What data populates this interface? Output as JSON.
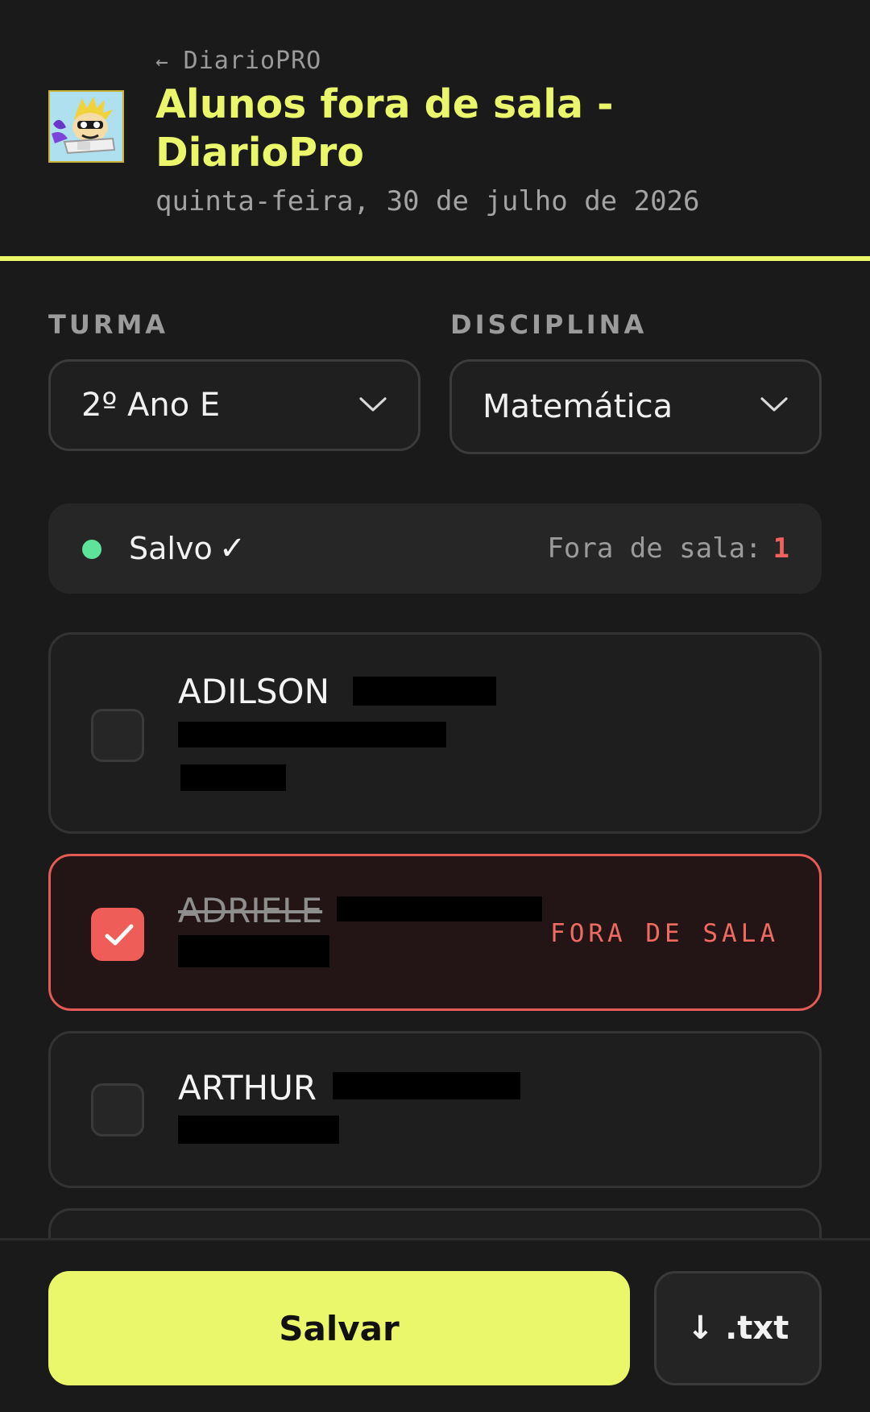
{
  "header": {
    "back_arrow": "←",
    "back_label": "DiarioPRO",
    "title": "Alunos fora de sala - DiarioPro",
    "date": "quinta-feira, 30 de julho de 2026"
  },
  "filters": {
    "turma": {
      "label": "TURMA",
      "value": "2º Ano E"
    },
    "disciplina": {
      "label": "DISCIPLINA",
      "value": "Matemática"
    }
  },
  "status": {
    "text": "Salvo",
    "check": "✓",
    "dot_color": "#5ee39a",
    "out_label": "Fora de sala:",
    "out_count": "1"
  },
  "students": [
    {
      "first_name": "ADILSON",
      "out": false
    },
    {
      "first_name": "ADRIELE",
      "out": true,
      "badge": "FORA DE SALA"
    },
    {
      "first_name": "ARTHUR",
      "out": false
    }
  ],
  "actions": {
    "save_label": "Salvar",
    "export_label": "↓ .txt"
  },
  "colors": {
    "accent": "#ebf76a",
    "danger": "#ee5d57",
    "background": "#1a1a1a"
  }
}
